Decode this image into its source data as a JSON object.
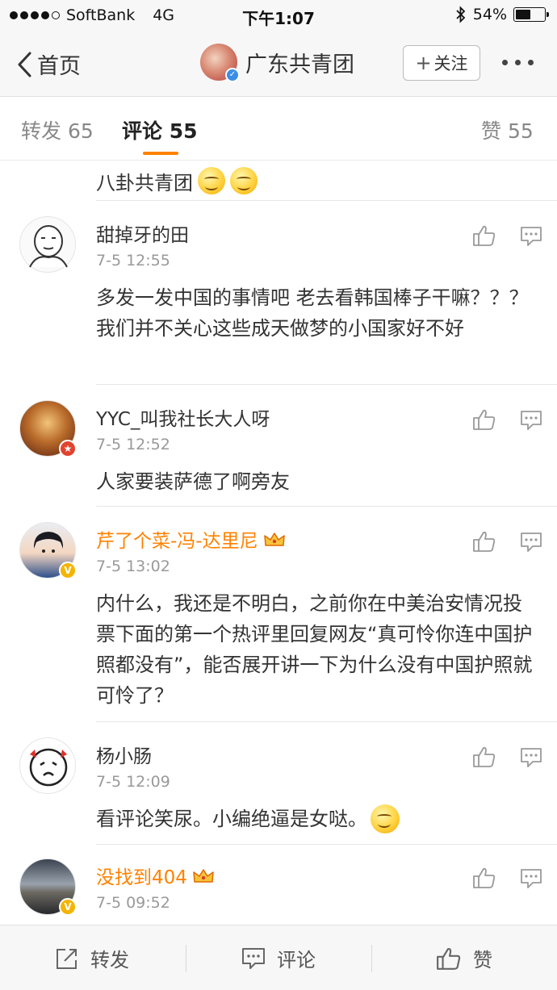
{
  "status_bar": {
    "carrier": "SoftBank",
    "network": "4G",
    "time": "下午1:07",
    "battery_percent": "54%",
    "battery_level": 0.54,
    "signal_bars": 4
  },
  "nav": {
    "back_label": "首页",
    "title": "广东共青团",
    "follow_label": "关注"
  },
  "tabs": {
    "repost": "转发 65",
    "comments": "评论 55",
    "likes": "赞 55"
  },
  "partial_comment": {
    "text": "八卦共青团"
  },
  "comments": [
    {
      "name": "甜掉牙的田",
      "time": "7-5 12:55",
      "text": "多发一发中国的事情吧   老去看韩国棒子干嘛？？？我们并不关心这些成天做梦的小国家好不好",
      "vip": false
    },
    {
      "name": "YYC_叫我社长大人呀",
      "time": "7-5 12:52",
      "text": "人家要装萨德了啊旁友",
      "vip": false
    },
    {
      "name": "芹了个菜-冯-达里尼",
      "time": "7-5 13:02",
      "text": "内什么，我还是不明白，之前你在中美治安情况投票下面的第一个热评里回复网友“真可怜你连中国护照都没有”，能否展开讲一下为什么没有中国护照就可怜了？",
      "vip": true
    },
    {
      "name": "杨小肠",
      "time": "7-5 12:09",
      "text": "看评论笑尿。小编绝逼是女哒。",
      "vip": false
    },
    {
      "name": "没找到404",
      "time": "7-5 09:52",
      "text": "",
      "vip": true
    }
  ],
  "bottom_bar": {
    "repost": "转发",
    "comment": "评论",
    "like": "赞"
  },
  "colors": {
    "accent": "#ff8200",
    "vip_name": "#ff8200",
    "verified_blue": "#3a8ee6",
    "verified_gold": "#f4b400"
  }
}
